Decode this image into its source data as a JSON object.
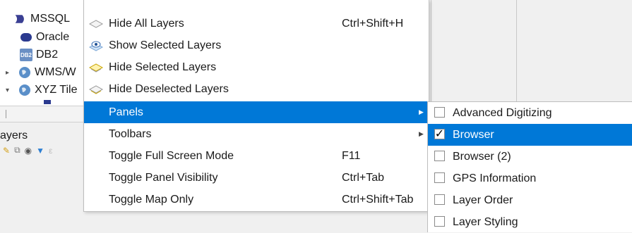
{
  "browser_items": [
    {
      "label": "MSSQL",
      "icon": "mssql-icon",
      "arrow": ""
    },
    {
      "label": "Oracle",
      "icon": "oracle-icon",
      "arrow": ""
    },
    {
      "label": "DB2",
      "icon": "db2-icon",
      "icon_text": "DB2",
      "arrow": ""
    },
    {
      "label": "WMS/W",
      "icon": "wms-icon",
      "arrow": "▸"
    },
    {
      "label": "XYZ Tile",
      "icon": "xyz-tiles-icon",
      "arrow": "▾"
    }
  ],
  "layers_panel": {
    "title": "ayers"
  },
  "menu": {
    "items": [
      {
        "label": "Hide All Layers",
        "shortcut": "Ctrl+Shift+H",
        "icon": "hide-all-layers-icon"
      },
      {
        "label": "Show Selected Layers",
        "shortcut": "",
        "icon": "show-selected-layers-icon"
      },
      {
        "label": "Hide Selected Layers",
        "shortcut": "",
        "icon": "hide-selected-layers-icon"
      },
      {
        "label": "Hide Deselected Layers",
        "shortcut": "",
        "icon": "hide-deselected-layers-icon"
      },
      {
        "label": "Panels",
        "shortcut": "",
        "submenu": true,
        "selected": true
      },
      {
        "label": "Toolbars",
        "shortcut": "",
        "submenu": true
      },
      {
        "label": "Toggle Full Screen Mode",
        "shortcut": "F11"
      },
      {
        "label": "Toggle Panel Visibility",
        "shortcut": "Ctrl+Tab"
      },
      {
        "label": "Toggle Map Only",
        "shortcut": "Ctrl+Shift+Tab"
      }
    ],
    "submenu_arrow": "▶"
  },
  "panels_submenu": {
    "items": [
      {
        "label": "Advanced Digitizing",
        "checked": false
      },
      {
        "label": "Browser",
        "checked": true,
        "selected": true
      },
      {
        "label": "Browser (2)",
        "checked": false
      },
      {
        "label": "GPS Information",
        "checked": false
      },
      {
        "label": "Layer Order",
        "checked": false
      },
      {
        "label": "Layer Styling",
        "checked": false
      }
    ],
    "check_glyph": "✓"
  },
  "colors": {
    "highlight": "#0078d7"
  }
}
